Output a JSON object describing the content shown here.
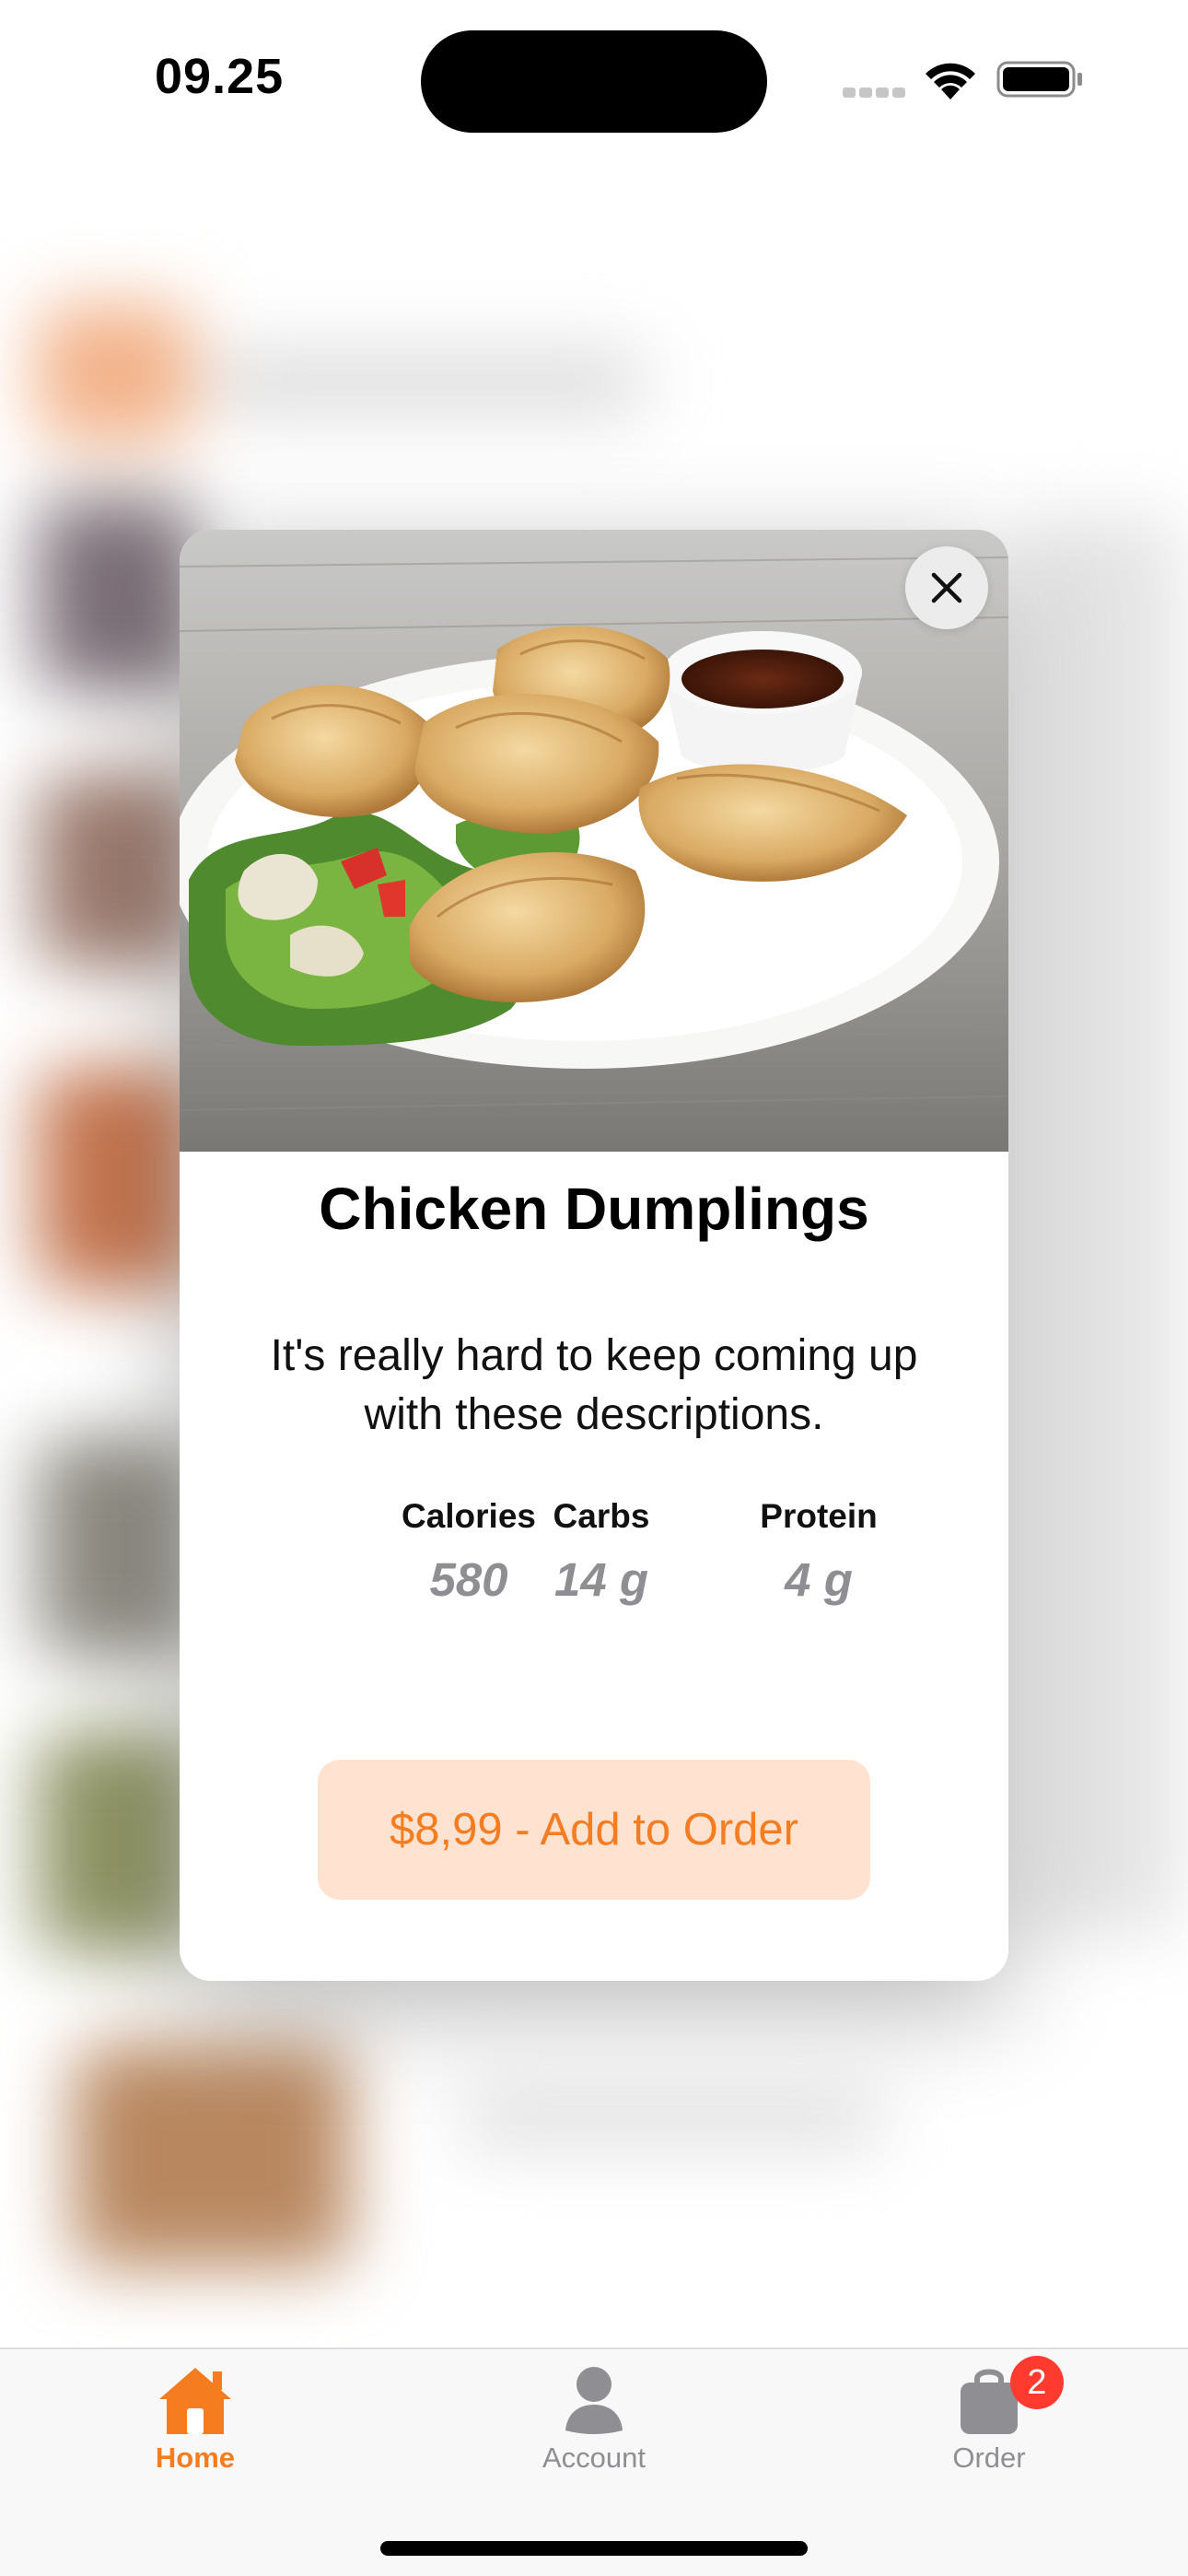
{
  "status_bar": {
    "time": "09.25"
  },
  "modal": {
    "close_icon": "close-icon",
    "image": "chicken-dumplings-photo",
    "title": "Chicken Dumplings",
    "description": "It's really hard to keep coming up with these descriptions.",
    "nutrition": {
      "calories_label": "Calories",
      "calories_value": "580",
      "carbs_label": "Carbs",
      "carbs_value": "14 g",
      "protein_label": "Protein",
      "protein_value": "4 g"
    },
    "add_button_label": "$8,99 - Add to Order"
  },
  "tab_bar": {
    "home_label": "Home",
    "account_label": "Account",
    "order_label": "Order",
    "order_badge": "2",
    "active_tab": "Home"
  },
  "colors": {
    "accent": "#f57c1f",
    "accent_light": "#ffe3d0",
    "badge": "#ff3b30",
    "secondary_text": "#8e8e93"
  }
}
